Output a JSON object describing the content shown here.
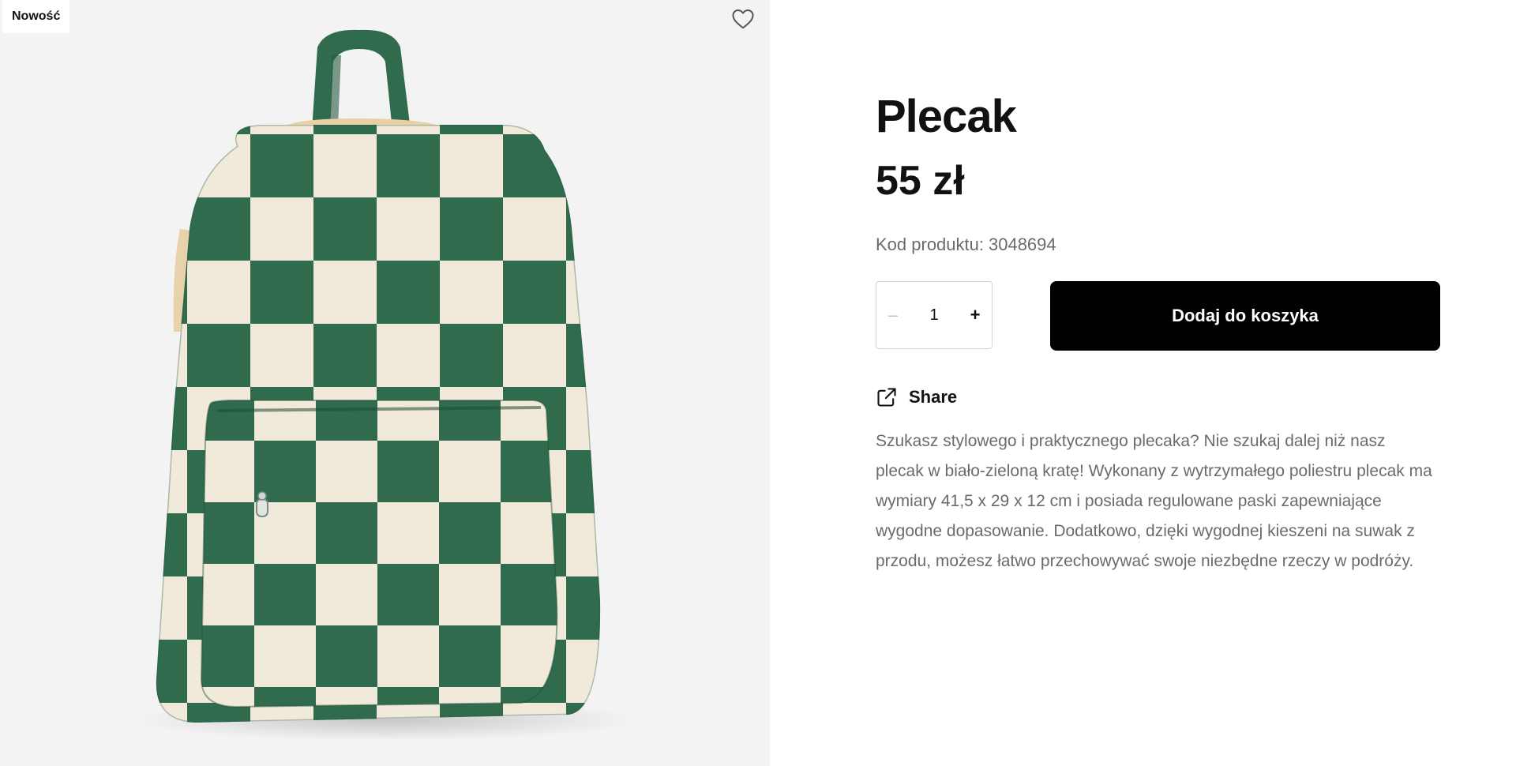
{
  "media": {
    "badge": "Nowość",
    "favorite_icon": "heart-outline-icon",
    "colors": {
      "green": "#2f6b4c",
      "cream": "#f1eadb",
      "background": "#f3f3f3"
    }
  },
  "product": {
    "title": "Plecak",
    "price": "55 zł",
    "code_label": "Kod produktu:",
    "code_value": "3048694"
  },
  "quantity": {
    "minus_label": "–",
    "value": "1",
    "plus_label": "+"
  },
  "actions": {
    "add_to_cart": "Dodaj do koszyka",
    "share": "Share",
    "share_icon": "external-link-icon"
  },
  "description": "Szukasz stylowego i praktycznego plecaka? Nie szukaj dalej niż nasz plecak w biało-zieloną kratę! Wykonany z wytrzymałego poliestru plecak ma wymiary 41,5 x 29 x 12 cm i posiada regulowane paski zapewniające wygodne dopasowanie. Dodatkowo, dzięki wygodnej kieszeni na suwak z przodu, możesz łatwo przechowywać swoje niezbędne rzeczy w podróży."
}
